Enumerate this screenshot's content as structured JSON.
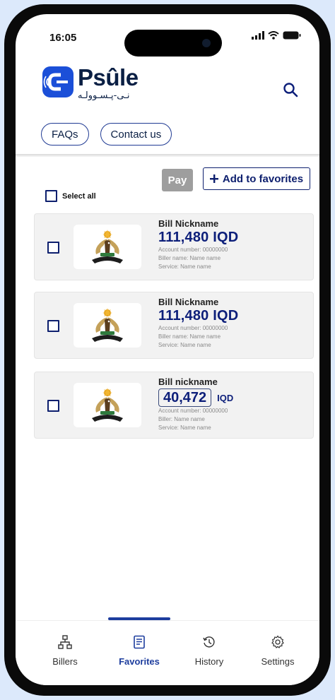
{
  "status": {
    "time": "16:05"
  },
  "brand": {
    "name": "Psûle",
    "subtitle": "نـی-پـسـوولـه"
  },
  "header": {
    "search_icon": "search-icon"
  },
  "chips": [
    {
      "label": "FAQs"
    },
    {
      "label": "Contact us"
    }
  ],
  "actions": {
    "pay_label": "Pay",
    "add_favorites_label": "Add to favorites",
    "add_icon": "plus-icon"
  },
  "select_all": {
    "label": "Select all",
    "checked": false
  },
  "bills": [
    {
      "nickname": "Bill Nickname",
      "amount": "111,480 IQD",
      "account": "Account number: 00000000",
      "biller": "Biller name: Name name",
      "service": "Service: Name name"
    },
    {
      "nickname": "Bill Nickname",
      "amount": "111,480 IQD",
      "account": "Account number: 00000000",
      "biller": "Biller name: Name name",
      "service": "Service: Name name"
    },
    {
      "nickname": "Bill nickname",
      "amount_value": "40,472",
      "currency": "IQD",
      "account": "Account number: 00000000",
      "biller": "Biller: Name name",
      "service": "Service: Name name"
    }
  ],
  "nav": {
    "active": "Favorites",
    "items": [
      {
        "label": "Billers",
        "icon": "sitemap-icon"
      },
      {
        "label": "Favorites",
        "icon": "document-icon"
      },
      {
        "label": "History",
        "icon": "history-icon"
      },
      {
        "label": "Settings",
        "icon": "gear-icon"
      }
    ]
  },
  "colors": {
    "accent": "#1b4fd8",
    "primary_text": "#0d1f7a",
    "page_bg": "#dce9fb"
  }
}
